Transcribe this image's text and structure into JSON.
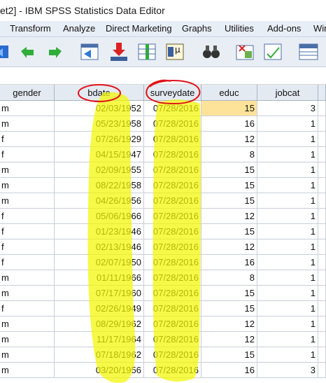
{
  "window": {
    "title": "et2] - IBM SPSS Statistics Data Editor"
  },
  "menu": [
    "Transform",
    "Analyze",
    "Direct Marketing",
    "Graphs",
    "Utilities",
    "Add-ons",
    "Win"
  ],
  "toolbar": {
    "icons": [
      "open-icon",
      "undo-icon",
      "redo-icon",
      "goto-case-icon",
      "goto-variable-icon",
      "variables-icon",
      "descriptives-icon",
      "find-icon",
      "insert-cases-icon",
      "split-file-icon",
      "select-cases-icon"
    ]
  },
  "columns": [
    "gender",
    "bdate",
    "surveydate",
    "educ",
    "jobcat"
  ],
  "rows": [
    [
      "m",
      "02/03/1952",
      "07/28/2016",
      "15",
      "3"
    ],
    [
      "m",
      "05/23/1958",
      "07/28/2016",
      "16",
      "1"
    ],
    [
      "f",
      "07/26/1929",
      "07/28/2016",
      "12",
      "1"
    ],
    [
      "f",
      "04/15/1947",
      "07/28/2016",
      "8",
      "1"
    ],
    [
      "m",
      "02/09/1955",
      "07/28/2016",
      "15",
      "1"
    ],
    [
      "m",
      "08/22/1958",
      "07/28/2016",
      "15",
      "1"
    ],
    [
      "m",
      "04/26/1956",
      "07/28/2016",
      "15",
      "1"
    ],
    [
      "f",
      "05/06/1966",
      "07/28/2016",
      "12",
      "1"
    ],
    [
      "f",
      "01/23/1946",
      "07/28/2016",
      "15",
      "1"
    ],
    [
      "f",
      "02/13/1946",
      "07/28/2016",
      "12",
      "1"
    ],
    [
      "f",
      "02/07/1950",
      "07/28/2016",
      "16",
      "1"
    ],
    [
      "m",
      "01/11/1966",
      "07/28/2016",
      "8",
      "1"
    ],
    [
      "m",
      "07/17/1960",
      "07/28/2016",
      "15",
      "1"
    ],
    [
      "f",
      "02/26/1949",
      "07/28/2016",
      "15",
      "1"
    ],
    [
      "m",
      "08/29/1962",
      "07/28/2016",
      "12",
      "1"
    ],
    [
      "m",
      "11/17/1964",
      "07/28/2016",
      "12",
      "1"
    ],
    [
      "m",
      "07/18/1962",
      "07/28/2016",
      "15",
      "1"
    ],
    [
      "m",
      "03/20/1956",
      "07/28/2016",
      "16",
      "3"
    ]
  ],
  "colors": {
    "highlight": "#f2f500",
    "circle": "#e0141a",
    "selected_cell": "#fde39a"
  }
}
